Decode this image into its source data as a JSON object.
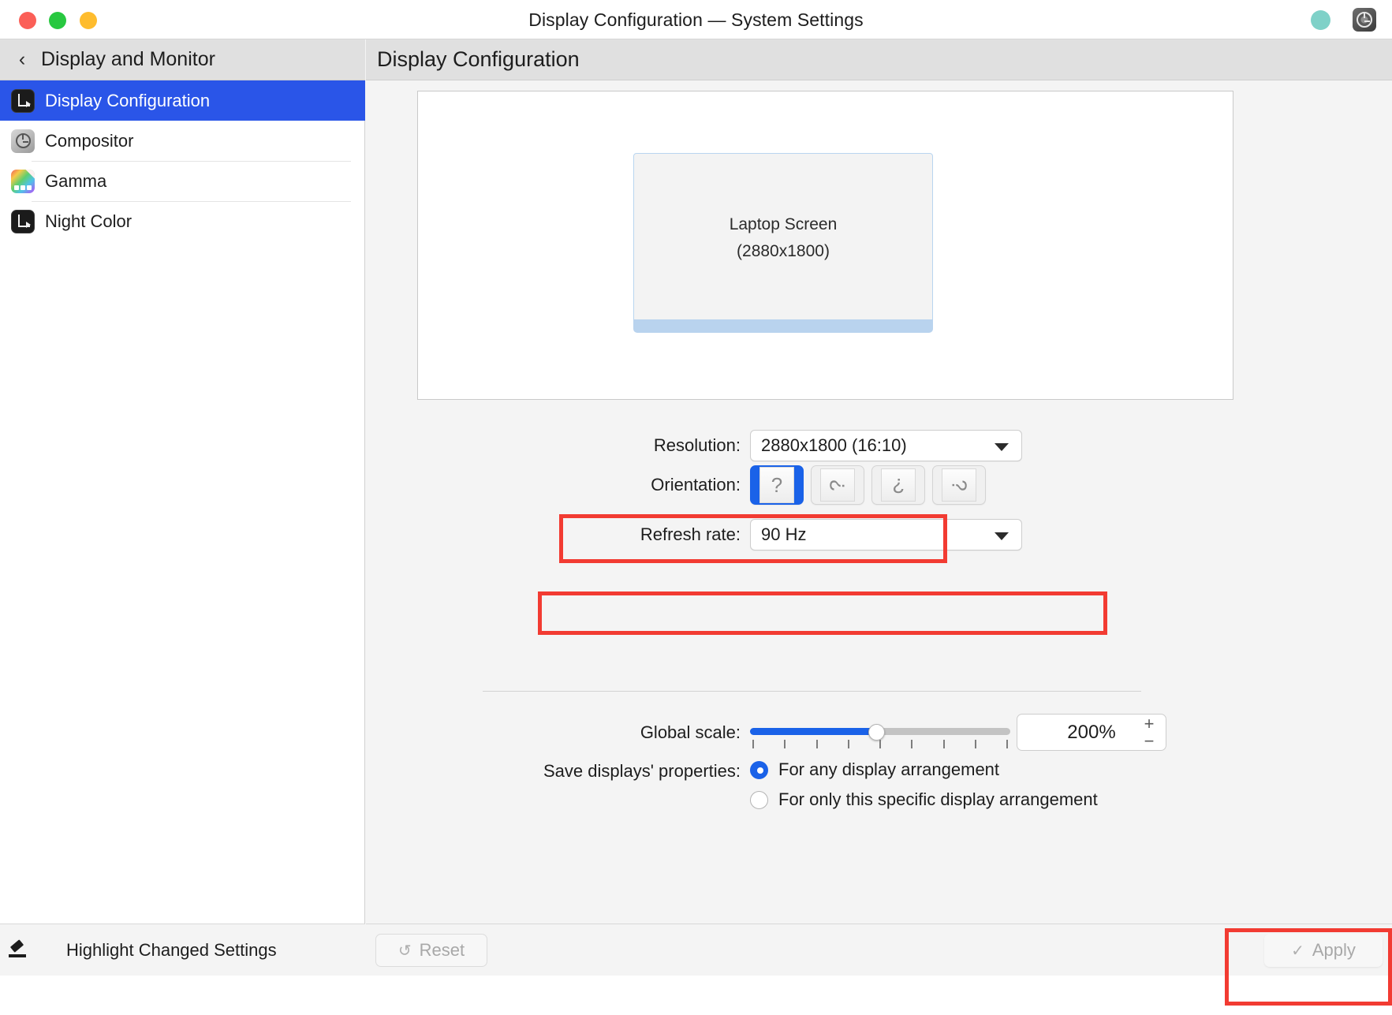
{
  "window": {
    "title": "Display Configuration — System Settings",
    "traffic_lights": [
      "close-red",
      "maximize-green",
      "minimize-yellow"
    ],
    "right_icons": [
      "teal-status-dot",
      "system-settings-app-icon"
    ]
  },
  "sidebar": {
    "header": {
      "back_icon": "chevron-left-icon",
      "title": "Display and Monitor"
    },
    "items": [
      {
        "label": "Display Configuration",
        "icon": "display-configuration-icon",
        "selected": true
      },
      {
        "label": "Compositor",
        "icon": "compositor-icon",
        "selected": false
      },
      {
        "label": "Gamma",
        "icon": "gamma-icon",
        "selected": false
      },
      {
        "label": "Night Color",
        "icon": "night-color-icon",
        "selected": false
      }
    ],
    "footer": {
      "icon": "highlighter-icon",
      "label": "Highlight Changed Settings"
    }
  },
  "main": {
    "header_title": "Display Configuration",
    "preview": {
      "monitor_name": "Laptop Screen",
      "monitor_resolution": "(2880x1800)"
    },
    "form": {
      "resolution": {
        "label": "Resolution:",
        "value": "2880x1800 (16:10)",
        "caret_icon": "chevron-down-icon"
      },
      "orientation": {
        "label": "Orientation:",
        "options": [
          {
            "name": "orientation-landscape",
            "glyph": "?",
            "selected": true
          },
          {
            "name": "orientation-portrait-left",
            "glyph": "?",
            "selected": false
          },
          {
            "name": "orientation-landscape-flipped",
            "glyph": "?",
            "selected": false
          },
          {
            "name": "orientation-portrait-right",
            "glyph": "?",
            "selected": false
          }
        ]
      },
      "refresh_rate": {
        "label": "Refresh rate:",
        "value": "90 Hz",
        "caret_icon": "chevron-down-icon"
      },
      "global_scale": {
        "label": "Global scale:",
        "value": "200%",
        "slider_percent": 48,
        "tick_count": 9,
        "increment_icon": "plus-icon",
        "decrement_icon": "minus-icon"
      },
      "save_properties": {
        "label": "Save displays' properties:",
        "options": [
          {
            "label": "For any display arrangement",
            "selected": true
          },
          {
            "label": "For only this specific display arrangement",
            "selected": false
          }
        ]
      }
    },
    "footer": {
      "reset_label": "Reset",
      "reset_icon": "undo-icon",
      "reset_enabled": false,
      "apply_label": "Apply",
      "apply_icon": "check-icon",
      "apply_enabled": false
    }
  },
  "annotations": {
    "highlight_color": "#f23b32",
    "boxes": [
      "refresh-rate-row",
      "global-scale-row",
      "apply-button"
    ]
  },
  "colors": {
    "accent_blue": "#2a55e8",
    "slider_blue": "#1a62e8",
    "highlight_red": "#f23b32",
    "monitor_border": "#b9d5f0",
    "monitor_base": "#b9d3ee"
  }
}
